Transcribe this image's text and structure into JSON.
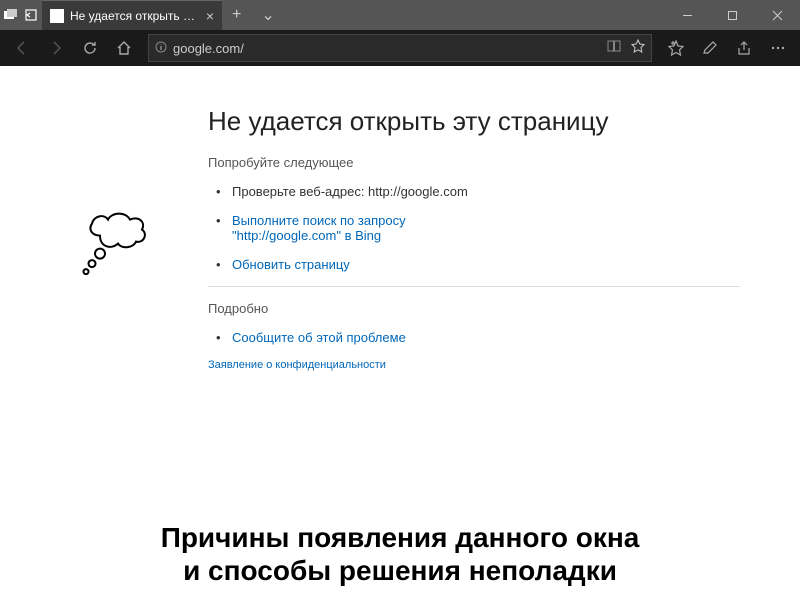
{
  "titlebar": {
    "tab_title": "Не удается открыть эту",
    "new_tab": "+",
    "chevron": "⌄"
  },
  "toolbar": {
    "url": "google.com/"
  },
  "error": {
    "title": "Не удается открыть эту страницу",
    "try_heading": "Попробуйте следующее",
    "check_address": "Проверьте веб-адрес: http://google.com",
    "search_bing_line1": "Выполните поиск по запросу",
    "search_bing_line2": "\"http://google.com\" в Bing",
    "refresh": "Обновить страницу",
    "details_heading": "Подробно",
    "report": "Сообщите об этой проблеме",
    "privacy": "Заявление о конфиденциальности"
  },
  "caption": {
    "line1": "Причины появления данного окна",
    "line2": "и способы решения неполадки"
  }
}
